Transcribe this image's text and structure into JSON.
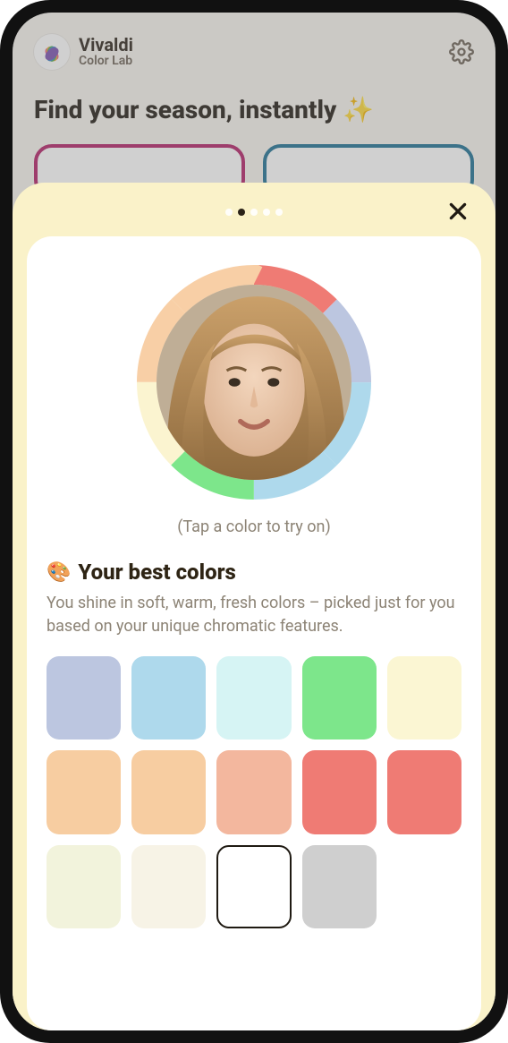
{
  "brand": {
    "title": "Vivaldi",
    "subtitle": "Color Lab"
  },
  "hero": "Find your season, instantly ✨",
  "sheet": {
    "page_count": 5,
    "active_index": 1,
    "hint": "(Tap a color to try on)",
    "section_icon": "🎨",
    "section_title": "Your best colors",
    "description": "You shine in soft, warm, fresh colors – picked just for you based on your unique chromatic features."
  },
  "ring_colors": [
    "#ef7b74",
    "#bcc6e0",
    "#aed9ec",
    "#aed9ec",
    "#7de68b",
    "#fbf4d0",
    "#f8cfa6",
    "#f8cfa6"
  ],
  "swatches": [
    {
      "hex": "#bcc6e0",
      "outlined": false
    },
    {
      "hex": "#aed9ec",
      "outlined": false
    },
    {
      "hex": "#d6f4f4",
      "outlined": false
    },
    {
      "hex": "#7de68b",
      "outlined": false
    },
    {
      "hex": "#fbf6d3",
      "outlined": false
    },
    {
      "hex": "#f7cda1",
      "outlined": false
    },
    {
      "hex": "#f7cda1",
      "outlined": false
    },
    {
      "hex": "#f3b79e",
      "outlined": false
    },
    {
      "hex": "#ef7b74",
      "outlined": false
    },
    {
      "hex": "#ef7b74",
      "outlined": false
    },
    {
      "hex": "#f2f3dc",
      "outlined": false
    },
    {
      "hex": "#f7f3e6",
      "outlined": false
    },
    {
      "hex": "#ffffff",
      "outlined": true
    },
    {
      "hex": "#cfcfcf",
      "outlined": false
    }
  ]
}
